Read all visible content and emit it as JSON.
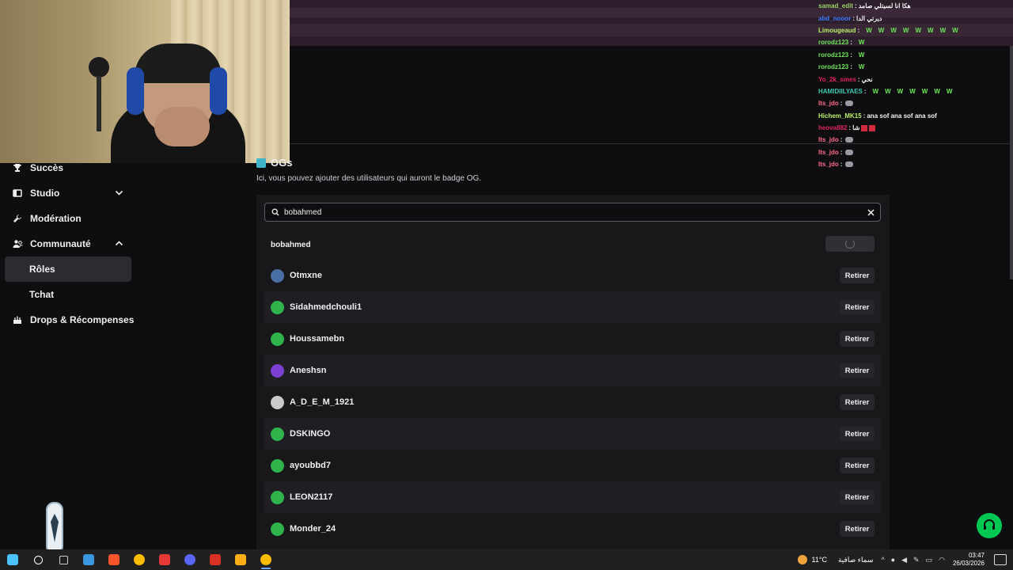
{
  "sidebar": {
    "items": [
      {
        "label": "Succès",
        "icon": "trophy-icon"
      },
      {
        "label": "Studio",
        "icon": "studio-icon",
        "chevron": "down"
      },
      {
        "label": "Modération",
        "icon": "wrench-icon"
      },
      {
        "label": "Communauté",
        "icon": "community-icon",
        "chevron": "up"
      },
      {
        "label": "Rôles",
        "active": true
      },
      {
        "label": "Tchat"
      },
      {
        "label": "Drops & Récompenses",
        "icon": "drops-icon"
      }
    ]
  },
  "section": {
    "title": "OGs",
    "description": "Ici, vous pouvez ajouter des utilisateurs qui auront le badge OG."
  },
  "search": {
    "value": "bobahmed"
  },
  "result": {
    "username": "bobahmed"
  },
  "og_list": {
    "remove_label": "Retirer",
    "users": [
      {
        "name": "Otmxne",
        "avatar_color": "#4a6fa5"
      },
      {
        "name": "Sidahmedchouli1",
        "avatar_color": "#2fb34a"
      },
      {
        "name": "Houssamebn",
        "avatar_color": "#2fb34a"
      },
      {
        "name": "Aneshsn",
        "avatar_color": "#7b3fd1"
      },
      {
        "name": "A_D_E_M_1921",
        "avatar_color": "#c9c9c9"
      },
      {
        "name": "DSKINGO",
        "avatar_color": "#2fb34a"
      },
      {
        "name": "ayoubbd7",
        "avatar_color": "#2fb34a"
      },
      {
        "name": "LEON2117",
        "avatar_color": "#2fb34a"
      },
      {
        "name": "Monder_24",
        "avatar_color": "#2fb34a"
      }
    ]
  },
  "chat": {
    "messages": [
      {
        "user": "samad_edit",
        "color": "#9bd36a",
        "text": "هكا انا لسيتلي صامد"
      },
      {
        "user": "abd_nooor",
        "color": "#3d7bff",
        "text": "ديرتي الدا"
      },
      {
        "user": "Limougeaud",
        "color": "#b9f06b",
        "text": "",
        "ws": 8
      },
      {
        "user": "rorodz123",
        "color": "#6ee55a",
        "text": "",
        "ws": 1
      },
      {
        "user": "rorodz123",
        "color": "#6ee55a",
        "text": "",
        "ws": 1
      },
      {
        "user": "rorodz123",
        "color": "#6ee55a",
        "text": "",
        "ws": 1
      },
      {
        "user": "Yo_2k_smes",
        "color": "#e0245e",
        "text": "نحي"
      },
      {
        "user": "HAMIDIILYAES",
        "color": "#41c9b0",
        "text": "",
        "ws": 7
      },
      {
        "user": "Its_jdo",
        "color": "#ff6b8b",
        "text": "",
        "moto": true
      },
      {
        "user": "Hichem_MK15",
        "color": "#b9f06b",
        "text": "ana sof ana sof ana sof"
      },
      {
        "user": "heova882",
        "color": "#e0245e",
        "text": "شا",
        "red": true
      },
      {
        "user": "Its_jdo",
        "color": "#ff6b8b",
        "text": "",
        "moto": true
      },
      {
        "user": "Its_jdo",
        "color": "#ff6b8b",
        "text": "",
        "moto": true
      },
      {
        "user": "Its_jdo",
        "color": "#ff6b8b",
        "text": "",
        "moto": true
      }
    ]
  },
  "taskbar": {
    "apps": [
      "windows-start-icon",
      "search-icon",
      "task-view-icon",
      "store-icon",
      "brave-icon",
      "chrome-icon",
      "app-icon",
      "discord-icon",
      "acrobat-icon",
      "rockstar-icon",
      "chrome-icon"
    ],
    "weather_temp": "11°C",
    "weather_text": "سماء صافية",
    "time": "03:47",
    "date": "26/03/2026"
  },
  "colors": {
    "accent_green": "#00c853",
    "panel_bg": "#18181b",
    "page_bg": "#0e0e10"
  }
}
